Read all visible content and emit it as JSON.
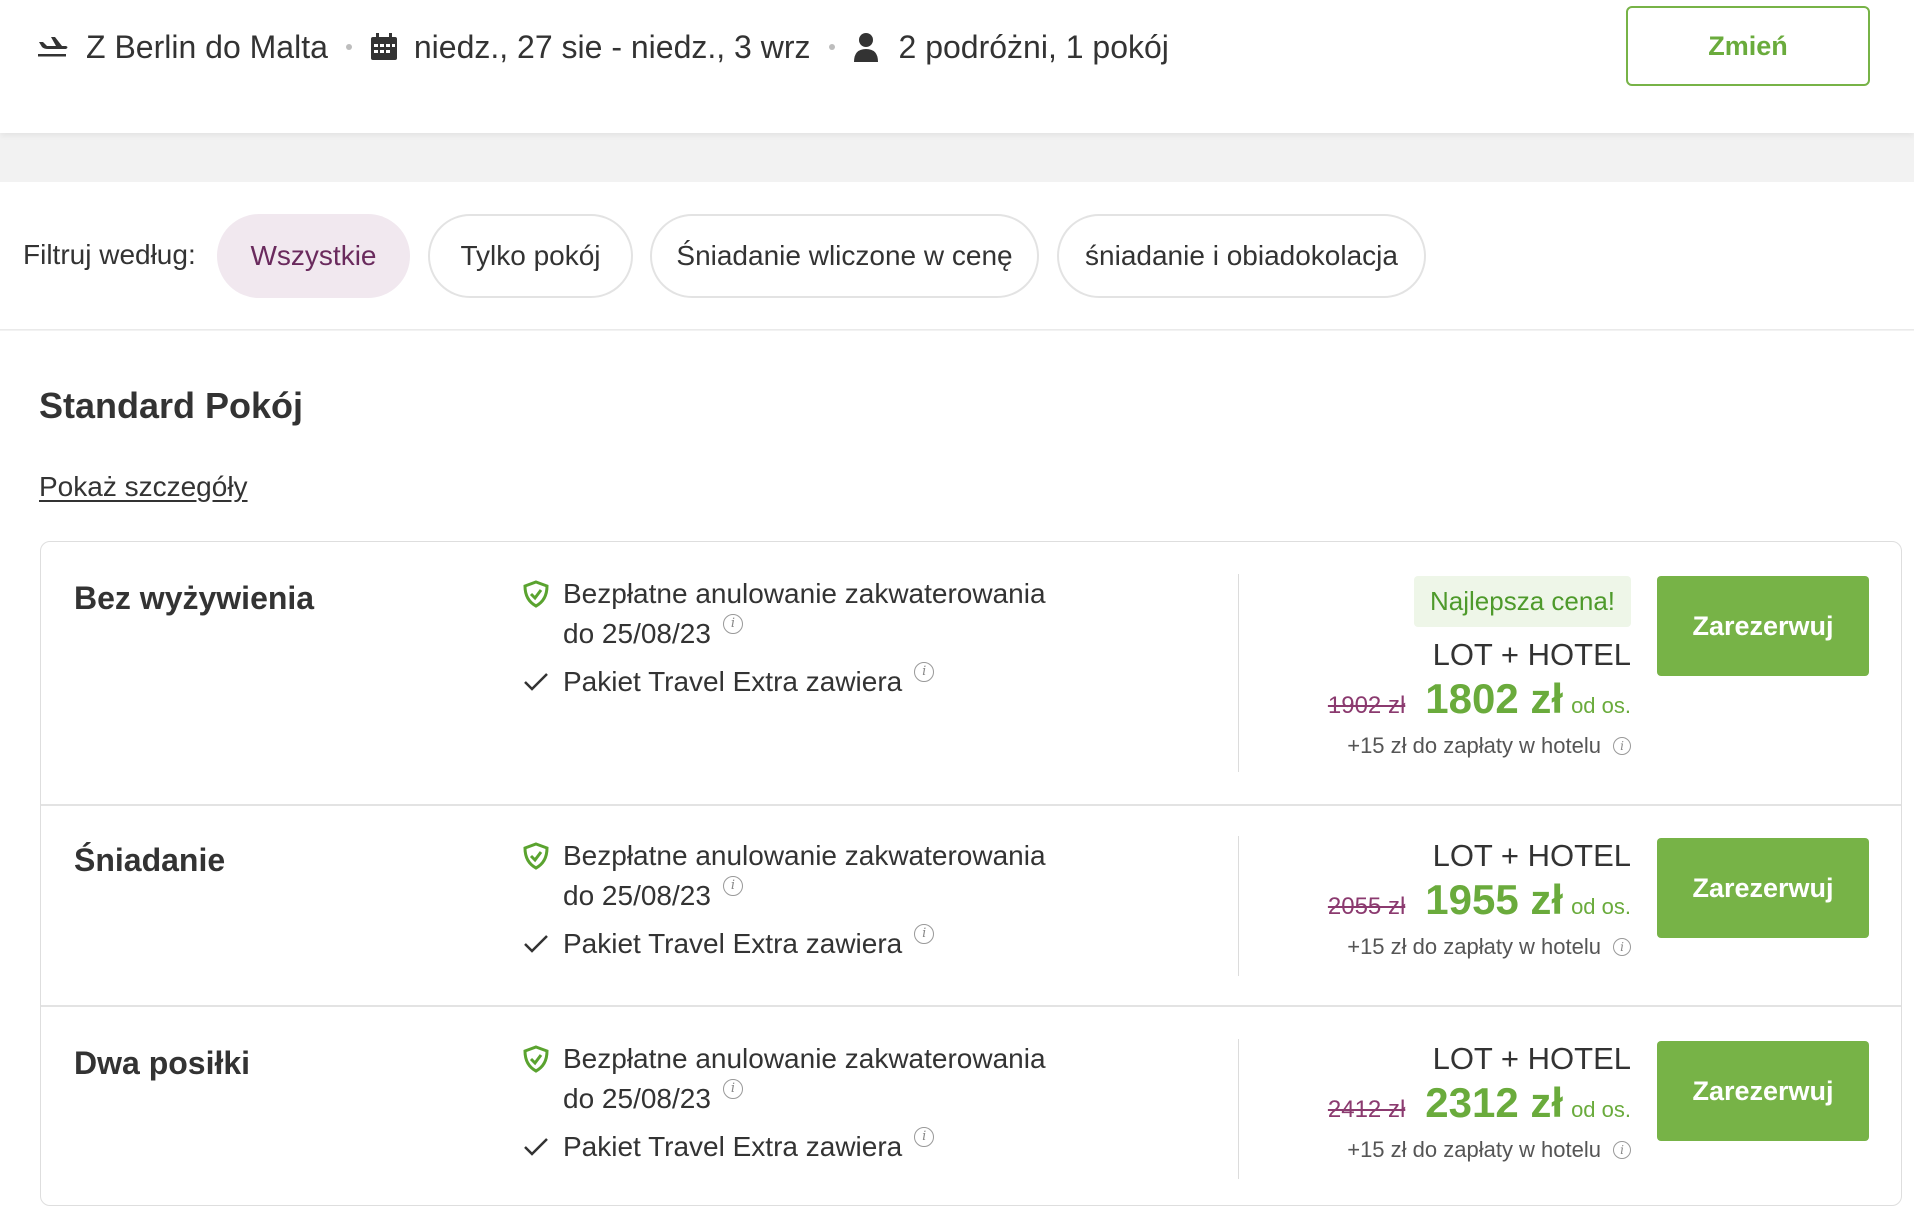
{
  "summary": {
    "route": "Z Berlin do Malta",
    "dates": "niedz., 27 sie - niedz., 3 wrz",
    "travellers": "2 podróżni, 1 pokój",
    "change_label": "Zmień",
    "icons": [
      "plane-icon",
      "calendar-icon",
      "person-icon"
    ]
  },
  "filters": {
    "label": "Filtruj według:",
    "options": [
      {
        "label": "Wszystkie",
        "active": true
      },
      {
        "label": "Tylko pokój",
        "active": false
      },
      {
        "label": "Śniadanie wliczone w cenę",
        "active": false
      },
      {
        "label": "śniadanie i obiadokolacja",
        "active": false
      }
    ]
  },
  "room": {
    "title": "Standard Pokój",
    "details_link": "Pokaż szczegóły",
    "offers": [
      {
        "name": "Bez wyżywienia",
        "cancel_text": "Bezpłatne anulowanie zakwaterowania",
        "cancel_date": "do 25/08/23",
        "package_text": "Pakiet Travel Extra zawiera",
        "badge": "Najlepsza cena!",
        "package_type": "LOT + HOTEL",
        "old_price": "1902 zł",
        "price": "1802 zł",
        "per_person": "od os.",
        "extra_fee": "+15 zł do zapłaty w hotelu",
        "book_label": "Zarezerwuj"
      },
      {
        "name": "Śniadanie",
        "cancel_text": "Bezpłatne anulowanie zakwaterowania",
        "cancel_date": "do 25/08/23",
        "package_text": "Pakiet Travel Extra zawiera",
        "package_type": "LOT + HOTEL",
        "old_price": "2055 zł",
        "price": "1955 zł",
        "per_person": "od os.",
        "extra_fee": "+15 zł do zapłaty w hotelu",
        "book_label": "Zarezerwuj"
      },
      {
        "name": "Dwa posiłki",
        "cancel_text": "Bezpłatne anulowanie zakwaterowania",
        "cancel_date": "do 25/08/23",
        "package_text": "Pakiet Travel Extra zawiera",
        "package_type": "LOT + HOTEL",
        "old_price": "2412 zł",
        "price": "2312 zł",
        "per_person": "od os.",
        "extra_fee": "+15 zł do zapłaty w hotelu",
        "book_label": "Zarezerwuj"
      }
    ]
  },
  "colors": {
    "accent_green": "#77b347",
    "active_filter_bg": "#f1e8ef",
    "active_filter_text": "#6a2a5d",
    "old_price": "#8b3a6f"
  }
}
